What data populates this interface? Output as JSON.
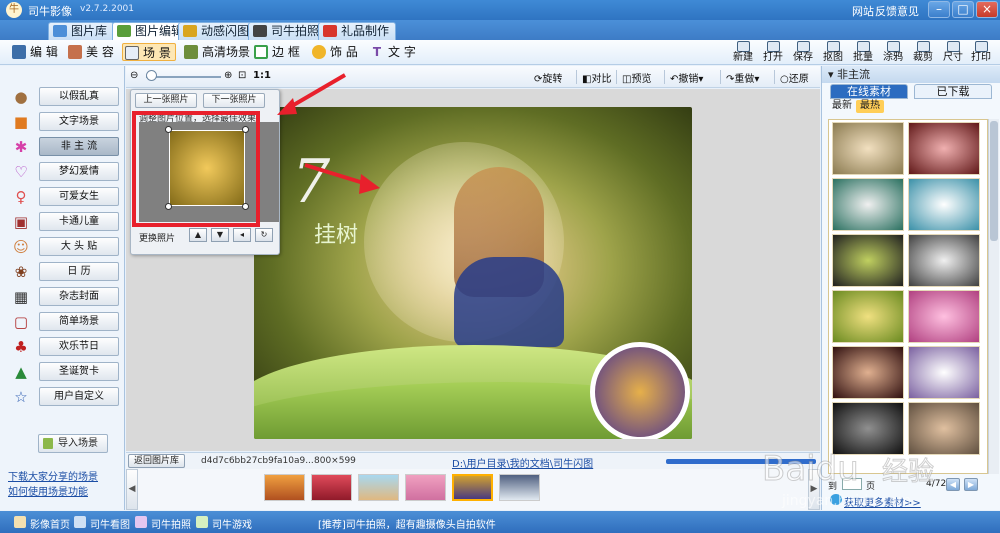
{
  "title": {
    "app_name": "司牛影像",
    "version": "v2.7.2.2001",
    "links": [
      "网站",
      "反馈意见"
    ]
  },
  "main_tabs": [
    "图片库",
    "图片编辑",
    "动感闪图",
    "司牛拍照",
    "礼品制作"
  ],
  "toolbar": {
    "tools": [
      "编 辑",
      "美 容",
      "场 景",
      "高清场景",
      "边 框",
      "饰 品",
      "文 字"
    ],
    "actions": [
      "新建",
      "打开",
      "保存",
      "抠图",
      "批量",
      "涂鸦",
      "裁剪",
      "尺寸",
      "打印"
    ]
  },
  "sidebar": {
    "items": [
      "以假乱真",
      "文字场景",
      "非 主 流",
      "梦幻爱情",
      "可爱女生",
      "卡通儿童",
      "大 头 贴",
      "日  历",
      "杂志封面",
      "简单场景",
      "欢乐节日",
      "圣诞贺卡",
      "用户自定义"
    ],
    "selected_index": 2,
    "import_label": "导入场景",
    "links": [
      "下载大家分享的场景",
      "如何使用场景功能"
    ]
  },
  "viewbar": {
    "zoom_label": "1:1",
    "tools": [
      "旋转",
      "对比",
      "预览",
      "撤销",
      "重做",
      "还原"
    ]
  },
  "popup": {
    "prev": "上一张照片",
    "next": "下一张照片",
    "hint": "调整图片位置，选择最佳效果",
    "change": "更换照片"
  },
  "canvas_text": {
    "logo": "7",
    "script": "挂树"
  },
  "infobar": {
    "back": "返回图片库",
    "hash": "d4d7c6bb27cb9fa10a9...",
    "size": "800×599",
    "path": "D:\\用户目录\\我的文档\\司牛闪图"
  },
  "filmstrip": {
    "count": 6,
    "selected_index": 4
  },
  "right_panel": {
    "header": "非主流",
    "tabs": [
      "在线素材",
      "已下载"
    ],
    "subtabs": [
      "最新",
      "最热"
    ],
    "pager": {
      "goto": "到",
      "page_label": "页",
      "total": "4/72"
    },
    "more_link": "获取更多素材>>"
  },
  "statusbar": {
    "items": [
      "影像首页",
      "司牛看图",
      "司牛拍照",
      "司牛游戏"
    ],
    "tip": "[推荐]司牛拍照，超有趣摄像头自拍软件"
  },
  "colors": {
    "accent": "#2f74c2",
    "highlight": "#e8202c",
    "selected_tool": "#fde7b4"
  }
}
